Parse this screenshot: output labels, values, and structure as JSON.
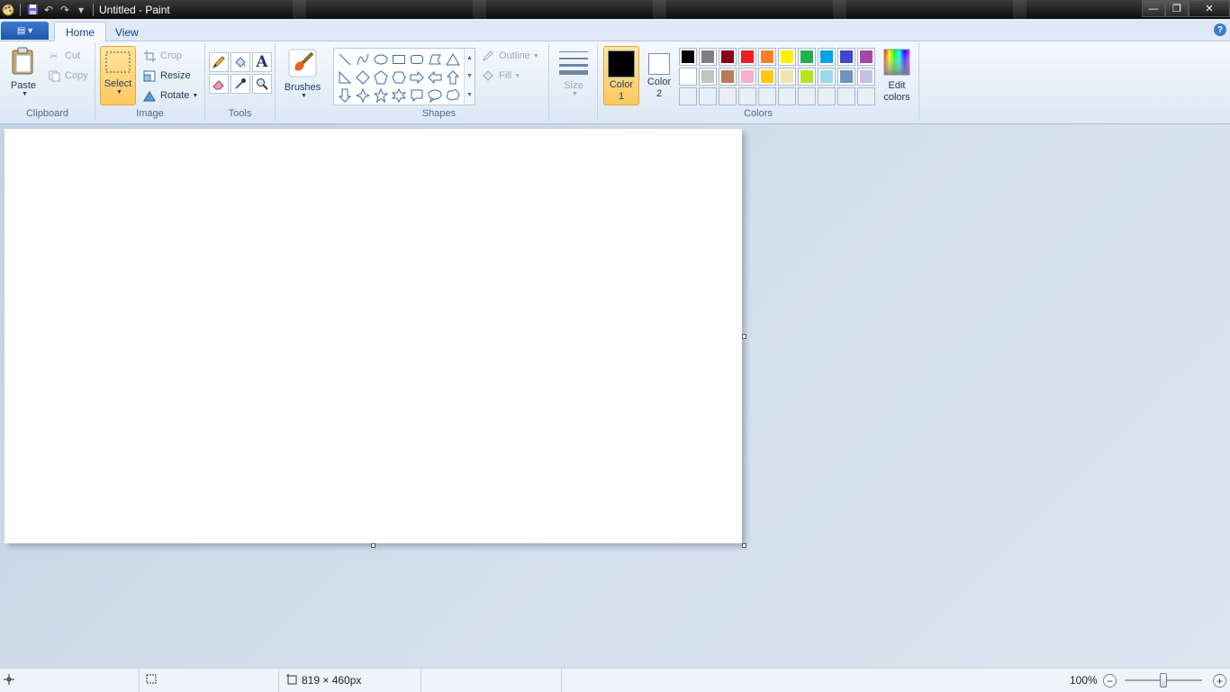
{
  "window": {
    "title": "Untitled - Paint",
    "minimize": "—",
    "maximize": "❐",
    "close": "✕"
  },
  "quick_access": {
    "app_icon": "paint-palette-icon",
    "save": "💾",
    "undo": "↶",
    "redo": "↷",
    "customize": "▾"
  },
  "ribbon": {
    "app_menu": "▤ ▾",
    "tabs": [
      {
        "label": "Home",
        "active": true
      },
      {
        "label": "View",
        "active": false
      }
    ],
    "help": "?",
    "groups": {
      "clipboard": {
        "label": "Clipboard",
        "paste": "Paste",
        "cut": "Cut",
        "copy": "Copy"
      },
      "image": {
        "label": "Image",
        "select": "Select",
        "crop": "Crop",
        "resize": "Resize",
        "rotate": "Rotate"
      },
      "tools": {
        "label": "Tools"
      },
      "brushes": {
        "label": "Brushes"
      },
      "shapes": {
        "label": "Shapes",
        "outline": "Outline",
        "fill": "Fill"
      },
      "size": {
        "label": "Size"
      },
      "colors": {
        "label": "Colors",
        "color1": "Color 1",
        "color2": "Color 2",
        "edit_colors": "Edit colors",
        "color1_value": "#000000",
        "color2_value": "#ffffff",
        "palette_row1": [
          "#000000",
          "#7f7f7f",
          "#880015",
          "#ed1c24",
          "#ff7f27",
          "#fff200",
          "#22b14c",
          "#00a2e8",
          "#3f48cc",
          "#a349a4"
        ],
        "palette_row2": [
          "#ffffff",
          "#c3c3c3",
          "#b97a57",
          "#ffaec9",
          "#ffc90e",
          "#efe4b0",
          "#b5e61d",
          "#99d9ea",
          "#7092be",
          "#c8bfe7"
        ]
      }
    }
  },
  "status": {
    "canvas_size": "819 × 460px",
    "zoom": "100%",
    "zoom_level": 1.0
  }
}
